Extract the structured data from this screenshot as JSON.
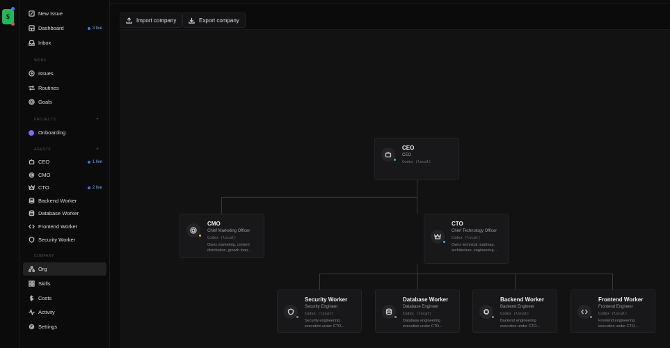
{
  "app": {
    "logo_glyph": "$"
  },
  "sidebar": {
    "top": [
      {
        "label": "New Issue",
        "icon": "edit-icon"
      },
      {
        "label": "Dashboard",
        "icon": "dashboard-icon",
        "badge": "3 live"
      },
      {
        "label": "Inbox",
        "icon": "inbox-icon"
      }
    ],
    "work_label": "WORK",
    "work": [
      {
        "label": "Issues",
        "icon": "circle-dot-icon"
      },
      {
        "label": "Routines",
        "icon": "repeat-icon"
      },
      {
        "label": "Goals",
        "icon": "target-icon"
      }
    ],
    "projects_label": "PROJECTS",
    "projects_plus": "+",
    "projects": [
      {
        "label": "Onboarding",
        "color": "#7c6cf2"
      }
    ],
    "agents_label": "AGENTS",
    "agents_plus": "+",
    "agents": [
      {
        "label": "CEO",
        "icon": "bot-icon",
        "badge": "1 live"
      },
      {
        "label": "CMO",
        "icon": "gear-icon"
      },
      {
        "label": "CTO",
        "icon": "crown-icon",
        "badge": "2 live"
      },
      {
        "label": "Backend Worker",
        "icon": "database-icon"
      },
      {
        "label": "Database Worker",
        "icon": "database-icon"
      },
      {
        "label": "Frontend Worker",
        "icon": "code-icon"
      },
      {
        "label": "Security Worker",
        "icon": "shield-icon"
      }
    ],
    "company_label": "COMPANY",
    "company": [
      {
        "label": "Org",
        "icon": "org-icon",
        "active": true
      },
      {
        "label": "Skills",
        "icon": "skills-icon"
      },
      {
        "label": "Costs",
        "icon": "dollar-icon"
      },
      {
        "label": "Activity",
        "icon": "activity-icon"
      },
      {
        "label": "Settings",
        "icon": "gear-icon"
      }
    ]
  },
  "toolbar": {
    "import_label": "Import company",
    "export_label": "Export company"
  },
  "org": {
    "ceo": {
      "name": "CEO",
      "role": "CEO",
      "adapter": "Codex (local)",
      "status_color": "#3bb8e8",
      "icon": "bot-icon"
    },
    "cmo": {
      "name": "CMO",
      "role": "Chief Marketing Officer",
      "adapter": "Codex (local)",
      "desc": "Owns marketing, content distribution, growth loop...",
      "status_color": "#e8c53b",
      "icon": "target-icon"
    },
    "cto": {
      "name": "CTO",
      "role": "Chief Technology Officer",
      "adapter": "Codex (local)",
      "desc": "Owns technical roadmap, architecture, engineering...",
      "status_color": "#3bb8e8",
      "icon": "crown-icon"
    },
    "workers": [
      {
        "name": "Security Worker",
        "role": "Security Engineer",
        "adapter": "Codex (local)",
        "desc": "Security engineering execution under CTO...",
        "status_color": "#8a8a8a",
        "icon": "shield-icon"
      },
      {
        "name": "Database Worker",
        "role": "Database Engineer",
        "adapter": "Codex (local)",
        "desc": "Database engineering execution under CTO...",
        "status_color": "#8a8a8a",
        "icon": "database-icon"
      },
      {
        "name": "Backend Worker",
        "role": "Backend Engineer",
        "adapter": "Codex (local)",
        "desc": "Backend engineering execution under CTO...",
        "status_color": "#8a8a8a",
        "icon": "chip-icon"
      },
      {
        "name": "Frontend Worker",
        "role": "Frontend Engineer",
        "adapter": "Codex (local)",
        "desc": "Frontend engineering execution under CTO...",
        "status_color": "#8a8a8a",
        "icon": "code-icon"
      }
    ]
  }
}
